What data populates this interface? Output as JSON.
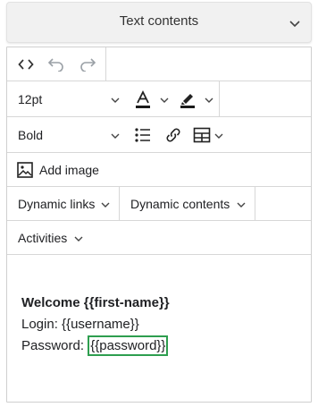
{
  "accordion": {
    "title": "Text contents"
  },
  "toolbar": {
    "font_size": "12pt",
    "font_weight": "Bold",
    "add_image_label": "Add image",
    "dynamic_links_label": "Dynamic links",
    "dynamic_contents_label": "Dynamic contents",
    "activities_label": "Activities"
  },
  "content": {
    "welcome_prefix": "Welcome ",
    "welcome_var": "{{first-name}}",
    "login_prefix": "Login: ",
    "login_var": "{{username}}",
    "password_prefix": "Password: ",
    "password_var": "{{password}}"
  },
  "colors": {
    "highlight_border": "#2e9e4f",
    "text_color_underline": "#1a1a1a"
  },
  "icons": [
    "code-icon",
    "undo-icon",
    "redo-icon",
    "text-color-icon",
    "highlighter-icon",
    "bullet-list-icon",
    "link-icon",
    "table-icon",
    "image-icon",
    "chevron-down-icon"
  ]
}
